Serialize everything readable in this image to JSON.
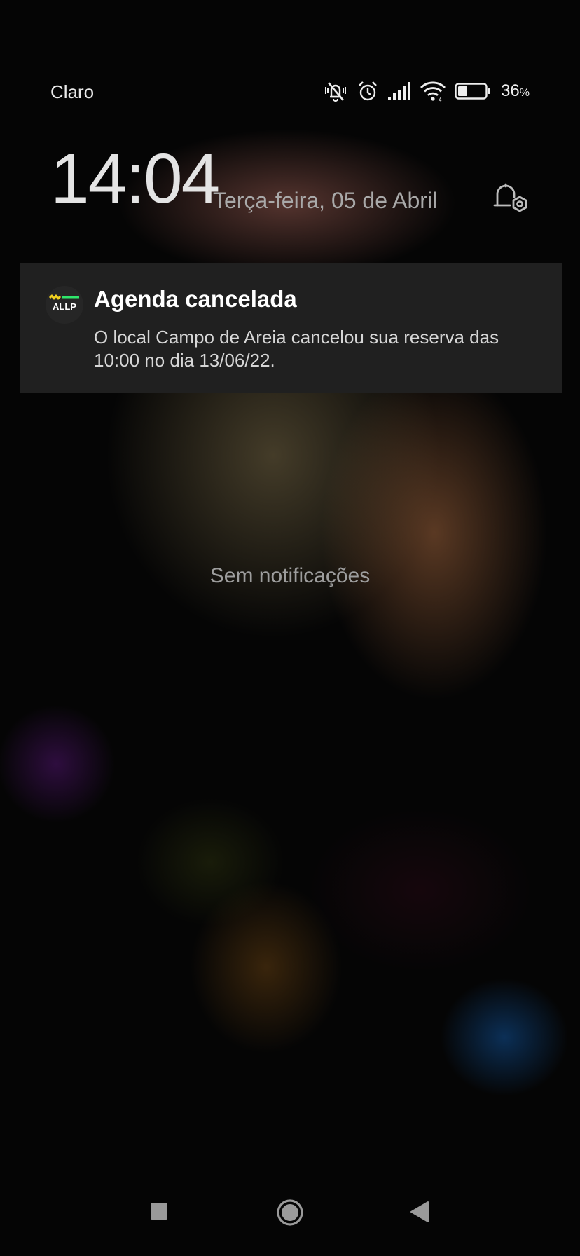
{
  "status_bar": {
    "carrier": "Claro",
    "icons": [
      "vibrate-off-icon",
      "alarm-icon",
      "signal-icon",
      "wifi-icon",
      "battery-icon"
    ],
    "battery_value": "36",
    "battery_unit": "%",
    "battery_level": 0.36
  },
  "lockscreen": {
    "time": "14:04",
    "date": "Terça-feira, 05 de Abril"
  },
  "notification": {
    "app_icon": "allp-logo-icon",
    "app_icon_text": "ALLP",
    "title": "Agenda cancelada",
    "body": "O local Campo de Areia cancelou sua reserva das 10:00 no dia 13/06/22."
  },
  "empty_state": "Sem notificações",
  "nav_bar": {
    "buttons": [
      "recents-button",
      "home-button",
      "back-button"
    ]
  },
  "colors": {
    "card_bg": "#202020",
    "logo_yellow": "#f4d21f",
    "logo_green": "#2ee66b"
  }
}
